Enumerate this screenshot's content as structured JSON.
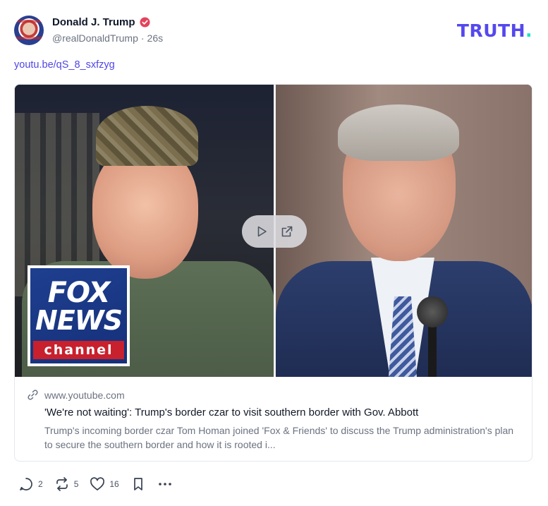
{
  "author": {
    "name": "Donald J. Trump",
    "handle": "@realDonaldTrump",
    "separator": "·",
    "time": "26s",
    "avatar_icon": "avatar-portrait-icon",
    "verified_icon": "verified-badge-icon"
  },
  "brand": {
    "logo_text": "TRUTH",
    "logo_dot": ".",
    "color": "#5448ee",
    "accent": "#17e3c9"
  },
  "post": {
    "link_text": "youtu.be/qS_8_sxfzyg"
  },
  "card": {
    "overlay": {
      "logo_line1": "FOX",
      "logo_line2": "NEWS",
      "logo_line3": "channel",
      "play_icon": "play-icon",
      "external_icon": "external-link-icon"
    },
    "domain": "www.youtube.com",
    "link_icon": "link-icon",
    "title": "'We're not waiting': Trump's border czar to visit southern border with Gov. Abbott",
    "description": "Trump's incoming border czar Tom Homan joined 'Fox & Friends' to discuss the Trump administration's plan to secure the southern border and how it is rooted i..."
  },
  "actions": {
    "reply_count": "2",
    "retruth_count": "5",
    "like_count": "16",
    "icons": [
      "reply-icon",
      "retruth-icon",
      "like-icon",
      "bookmark-icon",
      "more-icon"
    ]
  }
}
